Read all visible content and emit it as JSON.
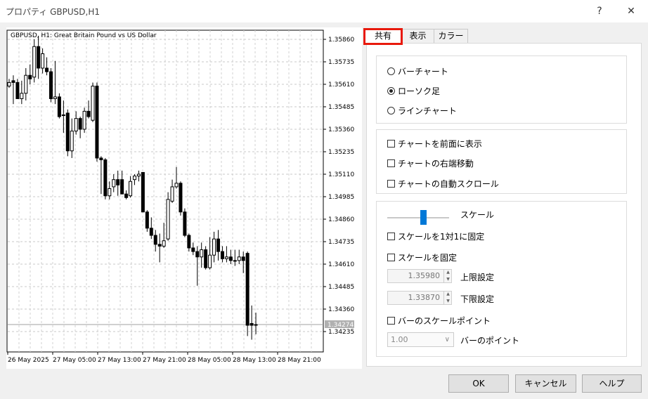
{
  "window": {
    "title": "プロパティ GBPUSD,H1",
    "help_glyph": "?",
    "close_glyph": "✕"
  },
  "chart": {
    "header": "GBPUSD, H1:  Great Britain Pound vs US Dollar",
    "price_labels": [
      "1.35860",
      "1.35735",
      "1.35610",
      "1.35485",
      "1.35360",
      "1.35235",
      "1.35110",
      "1.34985",
      "1.34860",
      "1.34735",
      "1.34610",
      "1.34485",
      "1.34360",
      "1.34235"
    ],
    "current_price": "1.34274",
    "time_labels": [
      "26 May 2025",
      "27 May 05:00",
      "27 May 13:00",
      "27 May 21:00",
      "28 May 05:00",
      "28 May 13:00",
      "28 May 21:00"
    ],
    "bull_color": "#ffffff",
    "bear_color": "#000000"
  },
  "chart_data": {
    "type": "candlestick",
    "title": "GBPUSD, H1:  Great Britain Pound vs US Dollar",
    "ylim": [
      1.3417,
      1.3595
    ],
    "candles": [
      {
        "o": 1.356,
        "h": 1.3564,
        "l": 1.3559,
        "c": 1.3562
      },
      {
        "o": 1.3563,
        "h": 1.3566,
        "l": 1.355,
        "c": 1.3562
      },
      {
        "o": 1.3562,
        "h": 1.3564,
        "l": 1.3555,
        "c": 1.3553
      },
      {
        "o": 1.3553,
        "h": 1.3563,
        "l": 1.355,
        "c": 1.3556
      },
      {
        "o": 1.3556,
        "h": 1.357,
        "l": 1.3552,
        "c": 1.3566
      },
      {
        "o": 1.3566,
        "h": 1.3572,
        "l": 1.3561,
        "c": 1.3564
      },
      {
        "o": 1.3565,
        "h": 1.3586,
        "l": 1.3562,
        "c": 1.3582
      },
      {
        "o": 1.3582,
        "h": 1.3588,
        "l": 1.3564,
        "c": 1.357
      },
      {
        "o": 1.357,
        "h": 1.3581,
        "l": 1.3567,
        "c": 1.3578
      },
      {
        "o": 1.357,
        "h": 1.3576,
        "l": 1.3566,
        "c": 1.3568
      },
      {
        "o": 1.3568,
        "h": 1.357,
        "l": 1.3551,
        "c": 1.3553
      },
      {
        "o": 1.3553,
        "h": 1.3574,
        "l": 1.355,
        "c": 1.3554
      },
      {
        "o": 1.3554,
        "h": 1.3556,
        "l": 1.3542,
        "c": 1.3543
      },
      {
        "o": 1.3544,
        "h": 1.3552,
        "l": 1.3534,
        "c": 1.3544
      },
      {
        "o": 1.3545,
        "h": 1.3547,
        "l": 1.3521,
        "c": 1.3524
      },
      {
        "o": 1.3524,
        "h": 1.3542,
        "l": 1.352,
        "c": 1.3535
      },
      {
        "o": 1.3535,
        "h": 1.3546,
        "l": 1.3533,
        "c": 1.3542
      },
      {
        "o": 1.3542,
        "h": 1.3543,
        "l": 1.3531,
        "c": 1.3536
      },
      {
        "o": 1.3536,
        "h": 1.3548,
        "l": 1.3534,
        "c": 1.3546
      },
      {
        "o": 1.3546,
        "h": 1.3552,
        "l": 1.3542,
        "c": 1.3543
      },
      {
        "o": 1.3541,
        "h": 1.3562,
        "l": 1.354,
        "c": 1.356
      },
      {
        "o": 1.356,
        "h": 1.3562,
        "l": 1.3518,
        "c": 1.352
      },
      {
        "o": 1.352,
        "h": 1.3521,
        "l": 1.35,
        "c": 1.3519
      },
      {
        "o": 1.3519,
        "h": 1.352,
        "l": 1.3497,
        "c": 1.3499
      },
      {
        "o": 1.3499,
        "h": 1.3507,
        "l": 1.3497,
        "c": 1.3503
      },
      {
        "o": 1.3504,
        "h": 1.3511,
        "l": 1.3501,
        "c": 1.3508
      },
      {
        "o": 1.3508,
        "h": 1.3513,
        "l": 1.3499,
        "c": 1.3505
      },
      {
        "o": 1.3508,
        "h": 1.3513,
        "l": 1.3501,
        "c": 1.35
      },
      {
        "o": 1.35,
        "h": 1.3502,
        "l": 1.3497,
        "c": 1.3498
      },
      {
        "o": 1.3499,
        "h": 1.351,
        "l": 1.3498,
        "c": 1.3507
      },
      {
        "o": 1.3508,
        "h": 1.3511,
        "l": 1.3505,
        "c": 1.351
      },
      {
        "o": 1.351,
        "h": 1.3513,
        "l": 1.3507,
        "c": 1.3511
      },
      {
        "o": 1.3512,
        "h": 1.3512,
        "l": 1.349,
        "c": 1.349
      },
      {
        "o": 1.349,
        "h": 1.3491,
        "l": 1.3479,
        "c": 1.3481
      },
      {
        "o": 1.3481,
        "h": 1.3487,
        "l": 1.3475,
        "c": 1.3477
      },
      {
        "o": 1.3477,
        "h": 1.348,
        "l": 1.3468,
        "c": 1.3472
      },
      {
        "o": 1.3472,
        "h": 1.3478,
        "l": 1.3462,
        "c": 1.3471
      },
      {
        "o": 1.3471,
        "h": 1.3484,
        "l": 1.347,
        "c": 1.3474
      },
      {
        "o": 1.3475,
        "h": 1.3501,
        "l": 1.3474,
        "c": 1.3497
      },
      {
        "o": 1.3496,
        "h": 1.3508,
        "l": 1.3495,
        "c": 1.3504
      },
      {
        "o": 1.3504,
        "h": 1.3515,
        "l": 1.3503,
        "c": 1.3506
      },
      {
        "o": 1.3506,
        "h": 1.3507,
        "l": 1.3488,
        "c": 1.349
      },
      {
        "o": 1.349,
        "h": 1.3492,
        "l": 1.3476,
        "c": 1.3477
      },
      {
        "o": 1.3477,
        "h": 1.3478,
        "l": 1.3468,
        "c": 1.347
      },
      {
        "o": 1.347,
        "h": 1.3473,
        "l": 1.3466,
        "c": 1.3468
      },
      {
        "o": 1.3468,
        "h": 1.3471,
        "l": 1.3449,
        "c": 1.3465
      },
      {
        "o": 1.3465,
        "h": 1.3473,
        "l": 1.3459,
        "c": 1.3469
      },
      {
        "o": 1.3469,
        "h": 1.3471,
        "l": 1.3458,
        "c": 1.3459
      },
      {
        "o": 1.3459,
        "h": 1.3476,
        "l": 1.3458,
        "c": 1.3466
      },
      {
        "o": 1.3466,
        "h": 1.3479,
        "l": 1.3462,
        "c": 1.3475
      },
      {
        "o": 1.3475,
        "h": 1.348,
        "l": 1.3463,
        "c": 1.3468
      },
      {
        "o": 1.3468,
        "h": 1.3471,
        "l": 1.3462,
        "c": 1.3464
      },
      {
        "o": 1.3464,
        "h": 1.3471,
        "l": 1.3462,
        "c": 1.3465
      },
      {
        "o": 1.3465,
        "h": 1.3469,
        "l": 1.3461,
        "c": 1.3463
      },
      {
        "o": 1.3463,
        "h": 1.3469,
        "l": 1.346,
        "c": 1.3463
      },
      {
        "o": 1.3463,
        "h": 1.3469,
        "l": 1.3461,
        "c": 1.3465
      },
      {
        "o": 1.3465,
        "h": 1.3468,
        "l": 1.3456,
        "c": 1.3463
      },
      {
        "o": 1.3467,
        "h": 1.3468,
        "l": 1.3421,
        "c": 1.3427
      },
      {
        "o": 1.3428,
        "h": 1.3438,
        "l": 1.3419,
        "c": 1.3427
      },
      {
        "o": 1.3427,
        "h": 1.3434,
        "l": 1.3422,
        "c": 1.34274
      }
    ]
  },
  "tabs": [
    {
      "label": "共有",
      "active": true
    },
    {
      "label": "表示",
      "active": false
    },
    {
      "label": "カラー",
      "active": false
    }
  ],
  "chart_type": {
    "bar_label": "バーチャート",
    "candle_label": "ローソク足",
    "line_label": "ラインチャート",
    "selected": "ローソク足"
  },
  "options": {
    "foreground_label": "チャートを前面に表示",
    "right_shift_label": "チャートの右端移動",
    "autoscroll_label": "チャートの自動スクロール"
  },
  "scale": {
    "scale_label": "スケール",
    "slider_level": 0.55,
    "one_to_one_label": "スケールを1対1に固定",
    "fix_scale_label": "スケールを固定",
    "max_value": "1.35980",
    "max_label": "上限設定",
    "min_value": "1.33870",
    "min_label": "下限設定",
    "bar_scale_point_label": "バーのスケールポイント",
    "bar_point_value": "1.00",
    "bar_point_label": "バーのポイント"
  },
  "buttons": {
    "ok": "OK",
    "cancel": "キャンセル",
    "help": "ヘルプ"
  }
}
